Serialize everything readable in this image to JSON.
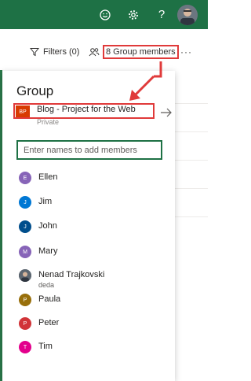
{
  "suite_bar": {
    "icons": [
      "smiley-icon",
      "gear-icon",
      "help-icon"
    ],
    "help_label": "?",
    "accent": "#1e7145"
  },
  "command_bar": {
    "filters_label": "Filters (0)",
    "members_label": "8 Group members",
    "more_label": "···"
  },
  "panel": {
    "title": "Group",
    "project": {
      "logo": "BP",
      "name": "Blog - Project for the Web",
      "privacy": "Private"
    },
    "add_members_placeholder": "Enter names to add members",
    "members": [
      {
        "initial": "E",
        "name": "Ellen",
        "color": "#8764b8"
      },
      {
        "initial": "J",
        "name": "Jim",
        "color": "#0078d4"
      },
      {
        "initial": "J",
        "name": "John",
        "color": "#004e8c"
      },
      {
        "initial": "M",
        "name": "Mary",
        "color": "#8764b8"
      },
      {
        "initial": "",
        "name": "Nenad Trajkovski",
        "sub": "deda",
        "color": "#4a5560"
      },
      {
        "initial": "P",
        "name": "Paula",
        "color": "#986f0b"
      },
      {
        "initial": "P",
        "name": "Peter",
        "color": "#d13438"
      },
      {
        "initial": "T",
        "name": "Tim",
        "color": "#e3008c"
      }
    ]
  },
  "annotation_color": "#e03a3a"
}
